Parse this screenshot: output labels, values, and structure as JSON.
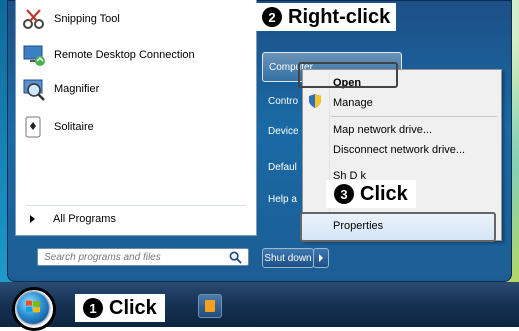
{
  "programs": [
    {
      "label": "Snipping Tool",
      "icon": "scissors-icon"
    },
    {
      "label": "Remote Desktop Connection",
      "icon": "remote-desktop-icon"
    },
    {
      "label": "Magnifier",
      "icon": "magnifier-icon"
    },
    {
      "label": "Solitaire",
      "icon": "solitaire-icon"
    }
  ],
  "all_programs": "All Programs",
  "search_placeholder": "Search programs and files",
  "right_pane": {
    "computer": "Computer",
    "items": [
      "Contro",
      "Device",
      "Defaul",
      "Help a"
    ]
  },
  "shutdown_label": "Shut down",
  "context_menu": {
    "open": "Open",
    "manage": "Manage",
    "map_drive": "Map network drive...",
    "disconnect_drive": "Disconnect network drive...",
    "partial": "Sh      D   k",
    "properties": "Properties"
  },
  "callouts": {
    "step1": {
      "num": "1",
      "text": "Click"
    },
    "step2": {
      "num": "2",
      "text": "Right-click"
    },
    "step3": {
      "num": "3",
      "text": "Click"
    }
  }
}
